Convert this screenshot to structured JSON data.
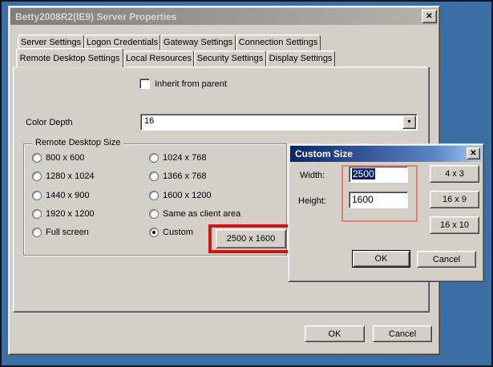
{
  "icons": {
    "close_icon": "✕",
    "dropdown_icon": "▼"
  },
  "main_dialog": {
    "title": "Betty2008R2(IE9) Server Properties",
    "tabs_row1": [
      "Server Settings",
      "Logon Credentials",
      "Gateway Settings",
      "Connection Settings"
    ],
    "tabs_row2": [
      "Remote Desktop Settings",
      "Local Resources",
      "Security Settings",
      "Display Settings"
    ],
    "active_tab": "Remote Desktop Settings",
    "inherit_checkbox": {
      "label": "Inherit from parent",
      "checked": false
    },
    "color_depth": {
      "label": "Color Depth",
      "value": "16"
    },
    "size_group": {
      "title": "Remote Desktop Size",
      "options_left": [
        "800 x 600",
        "1280 x 1024",
        "1440 x 900",
        "1920 x 1200",
        "Full screen"
      ],
      "options_right": [
        "1024 x 768",
        "1366 x 768",
        "1600 x 1200",
        "Same as client area",
        "Custom"
      ],
      "selected_option": "Custom",
      "custom_size_button": "2500 x 1600"
    },
    "ok_button": "OK",
    "cancel_button": "Cancel"
  },
  "custom_size_dialog": {
    "title": "Custom Size",
    "width": {
      "label": "Width:",
      "value": "2500",
      "selected": true
    },
    "height": {
      "label": "Height:",
      "value": "1600"
    },
    "ratio_buttons": [
      "4 x 3",
      "16 x 9",
      "16 x 10"
    ],
    "ok_button": "OK",
    "cancel_button": "Cancel"
  },
  "annotations": {
    "thick_box_color": "#d31414",
    "thin_box_color": "#de8383"
  },
  "colors": {
    "desktop": "#3A6EA5",
    "dialog_face": "#D4D0C8",
    "active_title_start": "#0a246a",
    "active_title_end": "#a6caf0"
  }
}
